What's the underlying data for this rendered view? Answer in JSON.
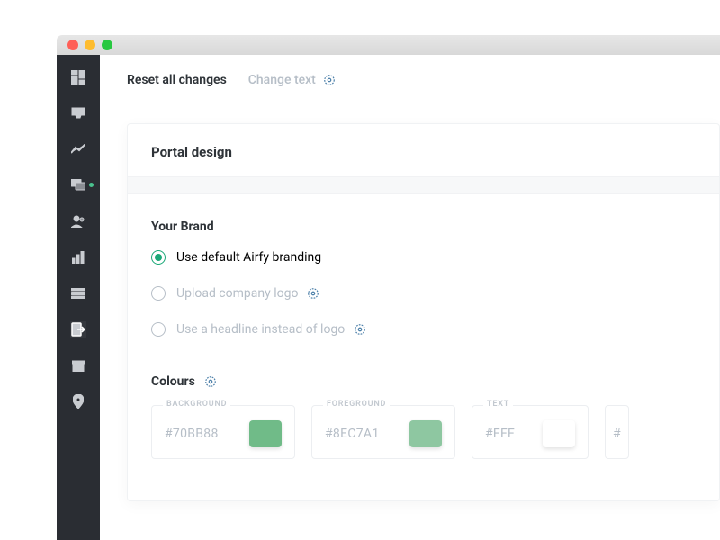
{
  "topbar": {
    "reset_label": "Reset all changes",
    "change_text_label": "Change text"
  },
  "card": {
    "title": "Portal design"
  },
  "brand": {
    "title": "Your Brand",
    "options": {
      "default": "Use default Airfy branding",
      "upload": "Upload company logo",
      "headline": "Use a headline instead of logo"
    }
  },
  "colours": {
    "title": "Colours",
    "background": {
      "label": "BACKGROUND",
      "value": "#70BB88",
      "swatch": "#70BB88"
    },
    "foreground": {
      "label": "FOREGROUND",
      "value": "#8EC7A1",
      "swatch": "#8EC7A1"
    },
    "text": {
      "label": "TEXT",
      "value": "#FFF",
      "swatch": "#FFFFFF"
    },
    "extra": {
      "label": "",
      "value": "#"
    }
  }
}
